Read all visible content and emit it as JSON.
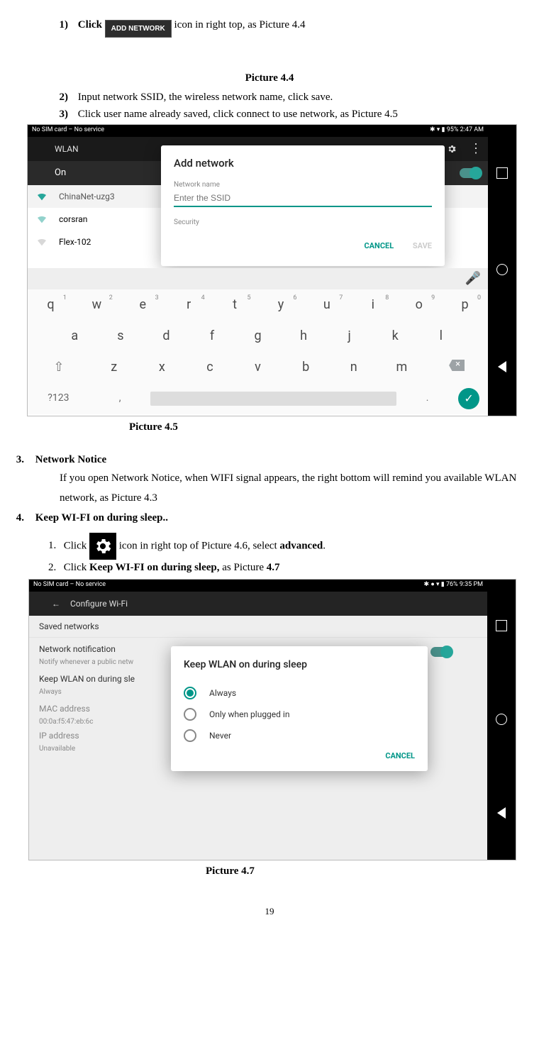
{
  "step1": {
    "num": "1)",
    "pre": "Click ",
    "button_label": "ADD NETWORK",
    "post": "  icon in right top, as Picture 4.4"
  },
  "caption44": "Picture 4.4",
  "step2": {
    "num": "2)",
    "text": "Input network SSID, the wireless network name, click save."
  },
  "step3": {
    "num": "3)",
    "text": "Click user name already saved, click connect to use network, as Picture 4.5"
  },
  "shot1": {
    "status_left": "No SIM card – No service",
    "status_right": "95%  2:47 AM",
    "appbar": "WLAN",
    "on_label": "On",
    "nets": [
      "ChinaNet-uzg3",
      "corsran",
      "Flex-102"
    ],
    "dialog": {
      "title": "Add network",
      "name_label": "Network name",
      "ssid_placeholder": "Enter the SSID",
      "security_label": "Security",
      "cancel": "CANCEL",
      "save": "SAVE"
    },
    "kb": {
      "r1": [
        "q",
        "w",
        "e",
        "r",
        "t",
        "y",
        "u",
        "i",
        "o",
        "p"
      ],
      "nums": [
        "1",
        "2",
        "3",
        "4",
        "5",
        "6",
        "7",
        "8",
        "9",
        "0"
      ],
      "r2": [
        "a",
        "s",
        "d",
        "f",
        "g",
        "h",
        "j",
        "k",
        "l"
      ],
      "r3": [
        "z",
        "x",
        "c",
        "v",
        "b",
        "n",
        "m"
      ],
      "sym": "?123",
      "comma": ",",
      "dot": "."
    }
  },
  "caption45": "Picture 4.5",
  "sec3": {
    "num": "3.",
    "title": "Network Notice",
    "body": "If you open Network Notice, when WIFI signal appears, the right bottom will remind you available WLAN network, as Picture 4.3"
  },
  "sec4": {
    "num": "4.",
    "title": "Keep WI-FI on during sleep..",
    "li1_pre": "Click ",
    "li1_post": "  icon in right top of Picture 4.6, select ",
    "li1_bold": "advanced",
    "li1_end": ".",
    "li2_pre": "Click ",
    "li2_bold": "Keep WI-FI on during sleep,",
    "li2_post": " as Picture ",
    "li2_bold2": "4.7"
  },
  "shot2": {
    "status_left": "No SIM card – No service",
    "status_right": "76%  9:35 PM",
    "appbar": "Configure Wi-Fi",
    "rows": [
      {
        "t": "Saved networks",
        "s": ""
      },
      {
        "t": "Network notification",
        "s": "Notify whenever a public netw"
      },
      {
        "t": "Keep WLAN on during sle",
        "s": "Always"
      },
      {
        "t": "MAC address",
        "s": "00:0a:f5:47:eb:6c"
      },
      {
        "t": "IP address",
        "s": "Unavailable"
      }
    ],
    "dialog": {
      "title": "Keep WLAN on during sleep",
      "opts": [
        "Always",
        "Only when plugged in",
        "Never"
      ],
      "cancel": "CANCEL"
    }
  },
  "caption47": "Picture 4.7",
  "page_num": "19"
}
